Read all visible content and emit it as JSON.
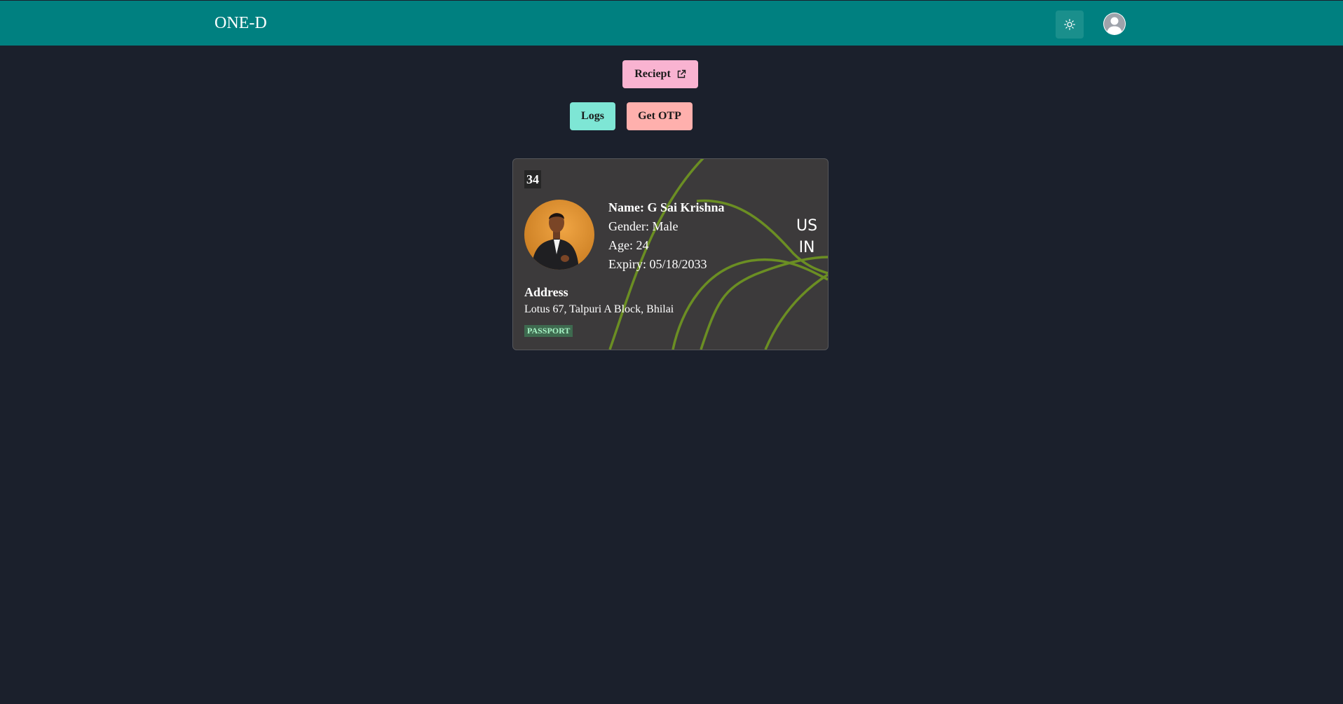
{
  "navbar": {
    "brand": "ONE-D",
    "theme_toggle_icon": "sun-icon",
    "account_icon": "user-avatar-icon",
    "background_color": "#008080"
  },
  "actions": {
    "receipt_label": "Reciept",
    "receipt_icon": "external-link-icon",
    "logs_label": "Logs",
    "otp_label": "Get OTP",
    "colors": {
      "receipt": "#f9b3d1",
      "logs": "#7ee6d5",
      "otp": "#ffb0ad"
    }
  },
  "card": {
    "id": "34",
    "name": "Name: G Sai Krishna",
    "gender": "Gender: Male",
    "age": "Age: 24",
    "expiry": "Expiry: 05/18/2033",
    "country_line1": "US",
    "country_line2": "IN",
    "address_title": "Address",
    "address": "Lotus 67, Talpuri A Block, Bhilai",
    "doc_type": "PASSPORT",
    "accent_color": "#6b8e23"
  }
}
